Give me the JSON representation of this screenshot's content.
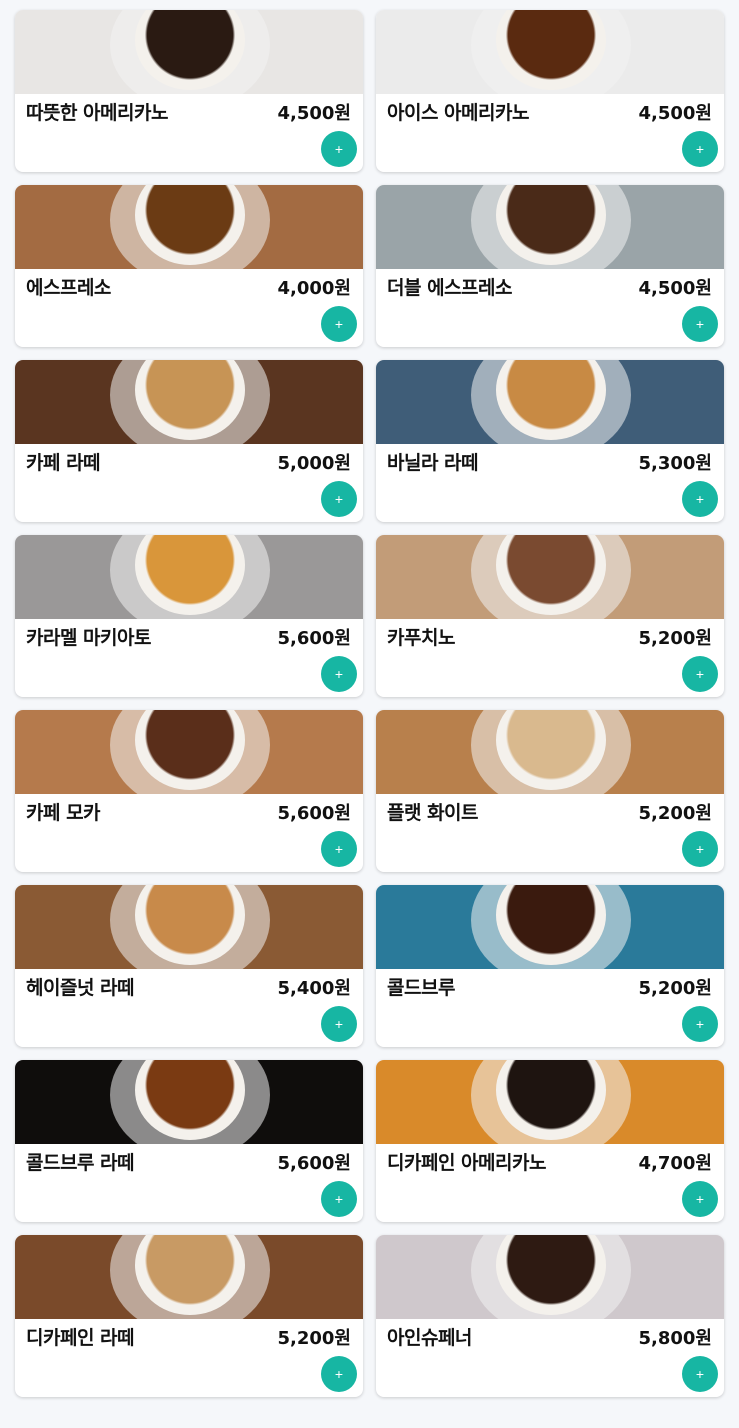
{
  "add_label": "+",
  "accent_color": "#17b6a3",
  "menu": [
    {
      "name": "따뜻한 아메리카노",
      "price": "4,500원",
      "bg": "#e8e6e4",
      "drink": "#2a1a12"
    },
    {
      "name": "아이스 아메리카노",
      "price": "4,500원",
      "bg": "#ebebeb",
      "drink": "#5a2a10"
    },
    {
      "name": "에스프레소",
      "price": "4,000원",
      "bg": "#a36b42",
      "drink": "#6b3b14"
    },
    {
      "name": "더블 에스프레소",
      "price": "4,500원",
      "bg": "#9aa4a8",
      "drink": "#4a2a18"
    },
    {
      "name": "카페 라떼",
      "price": "5,000원",
      "bg": "#5a3520",
      "drink": "#c79455"
    },
    {
      "name": "바닐라 라떼",
      "price": "5,300원",
      "bg": "#3f5d78",
      "drink": "#c88a44"
    },
    {
      "name": "카라멜 마키아토",
      "price": "5,600원",
      "bg": "#9a9898",
      "drink": "#d9963a"
    },
    {
      "name": "카푸치노",
      "price": "5,200원",
      "bg": "#c29c78",
      "drink": "#7a4a30"
    },
    {
      "name": "카페 모카",
      "price": "5,600원",
      "bg": "#b57a4c",
      "drink": "#5a2e1a"
    },
    {
      "name": "플랫 화이트",
      "price": "5,200원",
      "bg": "#b8804c",
      "drink": "#d9b98e"
    },
    {
      "name": "헤이즐넛 라떼",
      "price": "5,400원",
      "bg": "#8a5a34",
      "drink": "#c88a4a"
    },
    {
      "name": "콜드브루",
      "price": "5,200원",
      "bg": "#2a7a9a",
      "drink": "#3a1a0e"
    },
    {
      "name": "콜드브루 라떼",
      "price": "5,600원",
      "bg": "#0f0d0c",
      "drink": "#7a3a12"
    },
    {
      "name": "디카페인 아메리카노",
      "price": "4,700원",
      "bg": "#d98a2a",
      "drink": "#1e1410"
    },
    {
      "name": "디카페인 라떼",
      "price": "5,200원",
      "bg": "#7a4a2a",
      "drink": "#c89a64"
    },
    {
      "name": "아인슈페너",
      "price": "5,800원",
      "bg": "#cfc8cc",
      "drink": "#2e1a12"
    }
  ]
}
